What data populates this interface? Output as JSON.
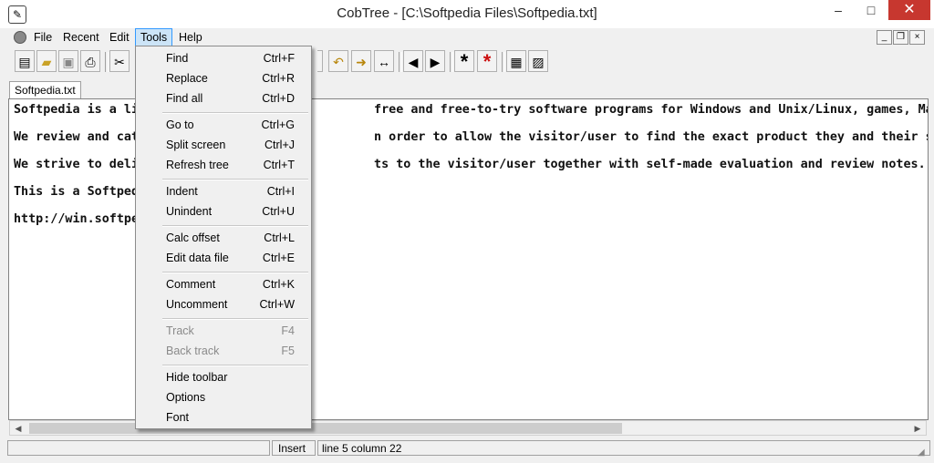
{
  "window": {
    "title": "CobTree - [C:\\Softpedia Files\\Softpedia.txt]",
    "minimize": "–",
    "maximize": "□",
    "close": "✕"
  },
  "menubar": [
    "File",
    "Recent",
    "Edit",
    "Tools",
    "Help"
  ],
  "mdi": {
    "minimize": "_",
    "restore": "❐",
    "close": "×"
  },
  "tab": "Softpedia.txt",
  "editor_lines": [
    "Softpedia is a li                                free and free-to-try software programs for Windows and Unix/Linux, games, Mac softwa",
    "We review and cat                                n order to allow the visitor/user to find the exact product they and their system ne",
    "We strive to deli                                ts to the visitor/user together with self-made evaluation and review notes.",
    "This is a Softped",
    "http://win.softpe"
  ],
  "tools_menu": [
    {
      "label": "Find",
      "shortcut": "Ctrl+F",
      "enabled": true
    },
    {
      "label": "Replace",
      "shortcut": "Ctrl+R",
      "enabled": true
    },
    {
      "label": "Find all",
      "shortcut": "Ctrl+D",
      "enabled": true
    },
    {
      "label": "Go to",
      "shortcut": "Ctrl+G",
      "enabled": true
    },
    {
      "label": "Split screen",
      "shortcut": "Ctrl+J",
      "enabled": true
    },
    {
      "label": "Refresh tree",
      "shortcut": "Ctrl+T",
      "enabled": true
    },
    {
      "label": "Indent",
      "shortcut": "Ctrl+I",
      "enabled": true
    },
    {
      "label": "Unindent",
      "shortcut": "Ctrl+U",
      "enabled": true
    },
    {
      "label": "Calc offset",
      "shortcut": "Ctrl+L",
      "enabled": true
    },
    {
      "label": "Edit data file",
      "shortcut": "Ctrl+E",
      "enabled": true
    },
    {
      "label": "Comment",
      "shortcut": "Ctrl+K",
      "enabled": true
    },
    {
      "label": "Uncomment",
      "shortcut": "Ctrl+W",
      "enabled": true
    },
    {
      "label": "Track",
      "shortcut": "F4",
      "enabled": false
    },
    {
      "label": "Back track",
      "shortcut": "F5",
      "enabled": false
    },
    {
      "label": "Hide toolbar",
      "shortcut": "",
      "enabled": true
    },
    {
      "label": "Options",
      "shortcut": "",
      "enabled": true
    },
    {
      "label": "Font",
      "shortcut": "",
      "enabled": true
    }
  ],
  "toolbar_icons": [
    "new-file-icon",
    "open-folder-icon",
    "save-icon",
    "print-icon",
    "cut-icon",
    "undo-icon",
    "goto-icon",
    "width-icon",
    "prev-icon",
    "next-icon",
    "asterisk-black-icon",
    "asterisk-red-icon",
    "calculator-icon",
    "options-icon"
  ],
  "status": {
    "mode": "Insert",
    "position": "line 5 column 22"
  },
  "colors": {
    "menu_highlight": "#cce4f7",
    "menu_highlight_border": "#3399ff",
    "close_button": "#c7372f",
    "red_asterisk": "#cc1111"
  }
}
